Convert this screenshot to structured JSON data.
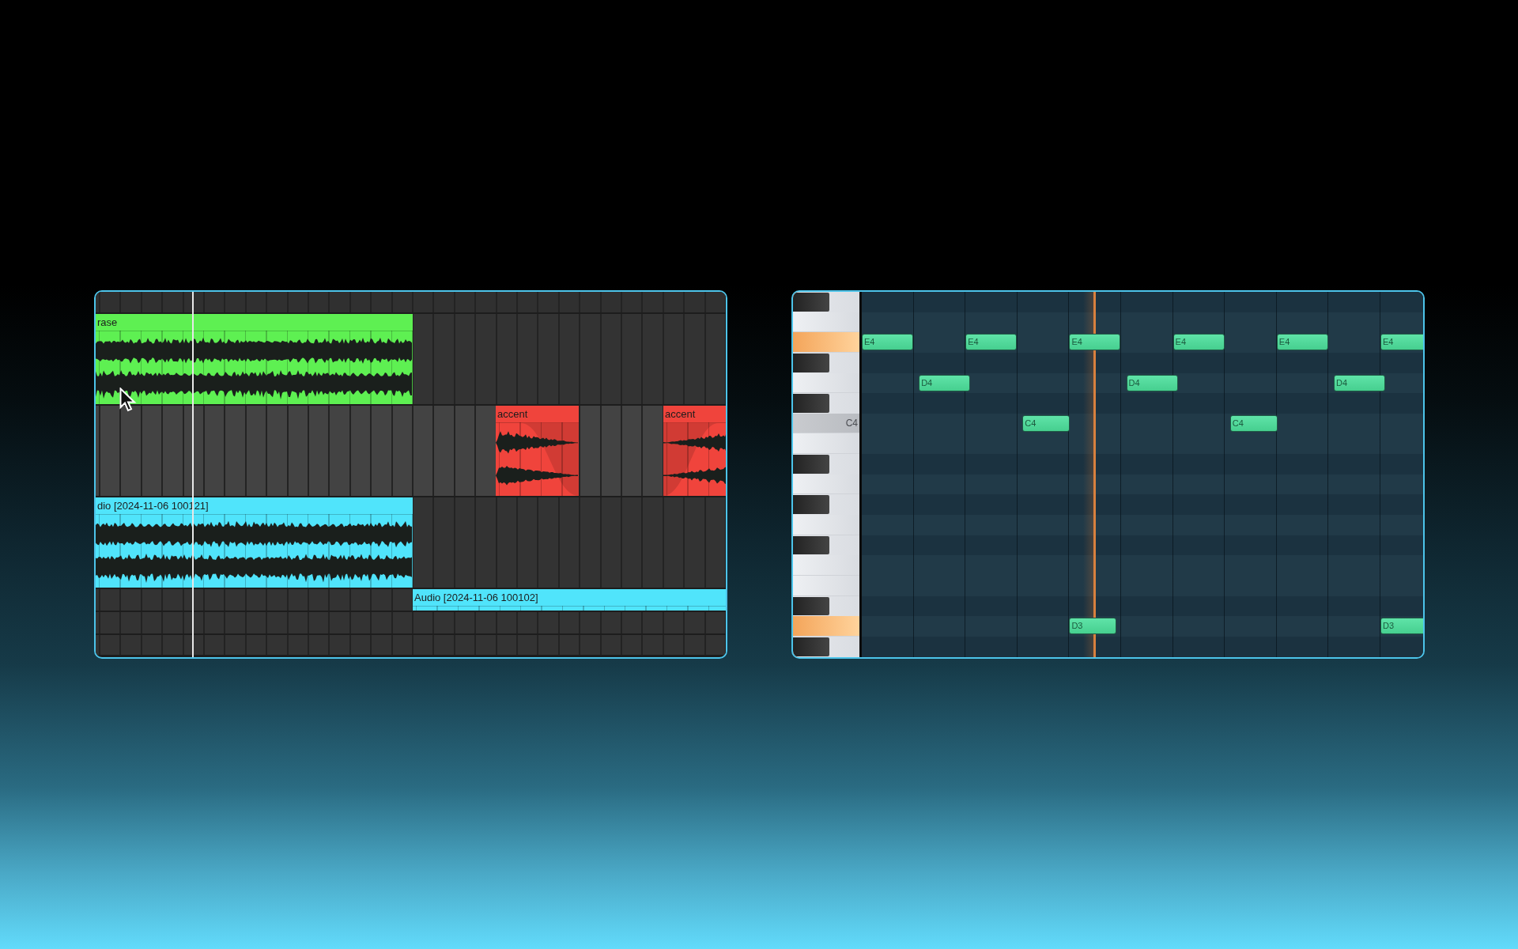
{
  "arrangement": {
    "tracks": [
      {
        "clips": [
          {
            "name": "rase",
            "color": "#5ef052",
            "kind": "loop"
          }
        ]
      },
      {
        "clips": [
          {
            "name": "accent",
            "color": "#f0443c",
            "kind": "fade_out"
          },
          {
            "name": "accent",
            "color": "#f0443c",
            "kind": "fade_in"
          }
        ]
      },
      {
        "clips": [
          {
            "name": "dio [2024-11-06 100121]",
            "color": "#50e4fb",
            "kind": "loop"
          }
        ]
      },
      {
        "clips": [
          {
            "name": "Audio [2024-11-06 100102]",
            "color": "#50e4fb"
          }
        ]
      }
    ]
  },
  "piano_roll": {
    "keys": [
      {
        "kind": "black",
        "highlighted": false
      },
      {
        "kind": "white",
        "highlighted": false
      },
      {
        "kind": "white",
        "highlighted": true
      },
      {
        "kind": "black",
        "highlighted": false
      },
      {
        "kind": "white",
        "highlighted": false
      },
      {
        "kind": "black",
        "highlighted": false
      },
      {
        "kind": "white",
        "highlighted": false,
        "label": "C4"
      },
      {
        "kind": "white",
        "highlighted": false
      },
      {
        "kind": "black",
        "highlighted": false
      },
      {
        "kind": "white",
        "highlighted": false
      },
      {
        "kind": "black",
        "highlighted": false
      },
      {
        "kind": "white",
        "highlighted": false
      },
      {
        "kind": "black",
        "highlighted": false
      },
      {
        "kind": "white",
        "highlighted": false
      },
      {
        "kind": "white",
        "highlighted": false
      },
      {
        "kind": "black",
        "highlighted": false
      },
      {
        "kind": "white",
        "highlighted": true
      },
      {
        "kind": "black",
        "highlighted": false
      }
    ],
    "notes": [
      {
        "label": "E4"
      },
      {
        "label": "E4"
      },
      {
        "label": "E4"
      },
      {
        "label": "E4"
      },
      {
        "label": "E4"
      },
      {
        "label": "E4"
      },
      {
        "label": "D4"
      },
      {
        "label": "D4"
      },
      {
        "label": "D4"
      },
      {
        "label": "C4"
      },
      {
        "label": "C4"
      },
      {
        "label": "D3"
      },
      {
        "label": "D3"
      }
    ]
  }
}
